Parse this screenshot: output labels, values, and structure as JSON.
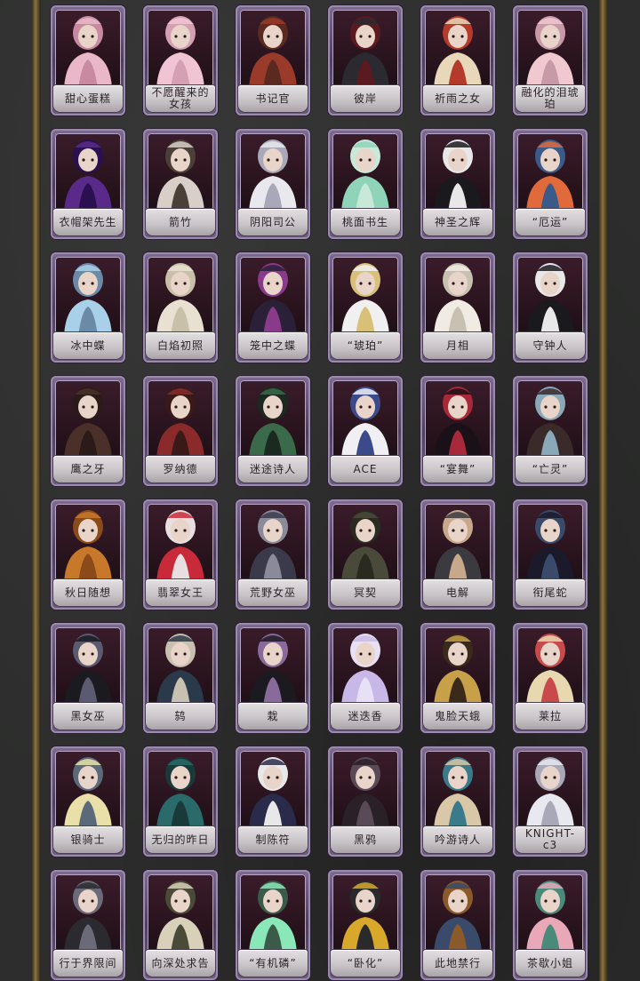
{
  "colors": {
    "background": "#2c2d2c",
    "card_border": "#7d6b92",
    "card_inner": "#2a141e",
    "label_plate": "#d8d4d6",
    "label_text": "#2a2226",
    "frame_gold": "#8a7440"
  },
  "skins": [
    {
      "name": "甜心蛋糕",
      "c1": "#e9b7c8",
      "c2": "#c88aa0"
    },
    {
      "name": "不愿醒来的女孩",
      "c1": "#f1c4d4",
      "c2": "#d6a0b4"
    },
    {
      "name": "书记官",
      "c1": "#9a3a2a",
      "c2": "#5a2a20"
    },
    {
      "name": "彼岸",
      "c1": "#2a2a30",
      "c2": "#5a1a20"
    },
    {
      "name": "祈雨之女",
      "c1": "#e8d7b8",
      "c2": "#b43a2a"
    },
    {
      "name": "融化的泪琥珀",
      "c1": "#f0c8d0",
      "c2": "#c89aa8"
    },
    {
      "name": "衣帽架先生",
      "c1": "#5a2a8a",
      "c2": "#2a1050"
    },
    {
      "name": "箭竹",
      "c1": "#d8d0c8",
      "c2": "#4a4038"
    },
    {
      "name": "阴阳司公",
      "c1": "#e8e8ee",
      "c2": "#a8a8b8"
    },
    {
      "name": "桃面书生",
      "c1": "#8fd4b8",
      "c2": "#c8e8d8"
    },
    {
      "name": "神圣之辉",
      "c1": "#1a1a1e",
      "c2": "#e8e8e8"
    },
    {
      "name": "“厄运”",
      "c1": "#e06a3a",
      "c2": "#3a5a8a"
    },
    {
      "name": "冰中蝶",
      "c1": "#a8d0e8",
      "c2": "#6a8aa8"
    },
    {
      "name": "白焰初照",
      "c1": "#e8e0d0",
      "c2": "#c8c0a8"
    },
    {
      "name": "笼中之蝶",
      "c1": "#2a2038",
      "c2": "#8a3a8a"
    },
    {
      "name": "“琥珀”",
      "c1": "#f0f0f0",
      "c2": "#d8c078"
    },
    {
      "name": "月相",
      "c1": "#f0ece4",
      "c2": "#c8c0b0"
    },
    {
      "name": "守钟人",
      "c1": "#1a1a1e",
      "c2": "#e8e8e8"
    },
    {
      "name": "鹰之牙",
      "c1": "#4a3028",
      "c2": "#2a1a18"
    },
    {
      "name": "罗纳德",
      "c1": "#8a2a2a",
      "c2": "#3a1a18"
    },
    {
      "name": "迷途诗人",
      "c1": "#3a6a4a",
      "c2": "#1a2a20"
    },
    {
      "name": "ACE",
      "c1": "#f0f0f4",
      "c2": "#3a4a8a"
    },
    {
      "name": "“宴舞”",
      "c1": "#1a1018",
      "c2": "#a82a3a"
    },
    {
      "name": "“亡灵”",
      "c1": "#3a2a2a",
      "c2": "#8aa8b8"
    },
    {
      "name": "秋日随想",
      "c1": "#c8782a",
      "c2": "#8a4a1a"
    },
    {
      "name": "翡翠女王",
      "c1": "#c82a3a",
      "c2": "#e8e0e0"
    },
    {
      "name": "荒野女巫",
      "c1": "#3a3a4a",
      "c2": "#8a8a9a"
    },
    {
      "name": "冥契",
      "c1": "#4a4a3a",
      "c2": "#2a2a20"
    },
    {
      "name": "电解",
      "c1": "#3a3a40",
      "c2": "#c8a88a"
    },
    {
      "name": "衔尾蛇",
      "c1": "#1a1a2a",
      "c2": "#3a4a6a"
    },
    {
      "name": "黑女巫",
      "c1": "#1a1a20",
      "c2": "#5a5a70"
    },
    {
      "name": "鸫",
      "c1": "#2a3a4a",
      "c2": "#c8c0b0"
    },
    {
      "name": "栽",
      "c1": "#1a1a20",
      "c2": "#8a6a9a"
    },
    {
      "name": "迷迭香",
      "c1": "#c8b8e8",
      "c2": "#e8e0f4"
    },
    {
      "name": "鬼脸天蛾",
      "c1": "#c8a04a",
      "c2": "#3a2a1a"
    },
    {
      "name": "莱拉",
      "c1": "#e8d8b0",
      "c2": "#c84a4a"
    },
    {
      "name": "银骑士",
      "c1": "#e8e0a8",
      "c2": "#5a6a7a"
    },
    {
      "name": "无归的昨日",
      "c1": "#2a6a6a",
      "c2": "#1a3a3a"
    },
    {
      "name": "制陈符",
      "c1": "#2a2a4a",
      "c2": "#e8e8e8"
    },
    {
      "name": "黑鸦",
      "c1": "#2a2028",
      "c2": "#5a4a58"
    },
    {
      "name": "吟游诗人",
      "c1": "#d8c8a8",
      "c2": "#3a7a8a"
    },
    {
      "name": "KNIGHT-c3",
      "c1": "#e8e8f0",
      "c2": "#a8a8b8"
    },
    {
      "name": "行于界限间",
      "c1": "#2a2a30",
      "c2": "#6a6a78"
    },
    {
      "name": "向深处求告",
      "c1": "#d8d0b8",
      "c2": "#4a4a38"
    },
    {
      "name": "“有机磷”",
      "c1": "#8ae8b8",
      "c2": "#3a5a4a"
    },
    {
      "name": "“卧化”",
      "c1": "#d8a82a",
      "c2": "#2a2a2a"
    },
    {
      "name": "此地禁行",
      "c1": "#3a4a6a",
      "c2": "#8a5a2a"
    },
    {
      "name": "茶歇小姐",
      "c1": "#e8a8b8",
      "c2": "#4a8a7a"
    }
  ]
}
